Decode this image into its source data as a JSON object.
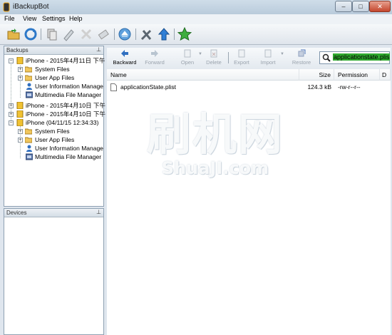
{
  "window": {
    "title": "iBackupBot",
    "minimize": "–",
    "maximize": "□",
    "close": "✕"
  },
  "menu": [
    "File",
    "View",
    "Settings",
    "Help"
  ],
  "backups_panel": {
    "title": "Backups",
    "pin": "📌",
    "items": [
      {
        "label": "iPhone - 2015年4月11日 下午",
        "children": [
          "System Files",
          "User App Files",
          "User Information Manage",
          "Multimedia File Manager"
        ]
      },
      {
        "label": "iPhone - 2015年4月10日 下午"
      },
      {
        "label": "iPhone - 2015年4月10日 下午"
      },
      {
        "label": "iPhone (04/11/15 12:34:33)",
        "children": [
          "System Files",
          "User App Files",
          "User Information Manage",
          "Multimedia File Manager"
        ]
      }
    ]
  },
  "devices_panel": {
    "title": "Devices",
    "pin": "📌"
  },
  "navbar": {
    "backward": "Backward",
    "forward": "Forward",
    "open": "Open",
    "delete": "Delete",
    "export": "Export",
    "import": "Import",
    "restore": "Restore"
  },
  "search": {
    "value": "applicationstate.plis"
  },
  "file_table": {
    "columns": [
      "Name",
      "Size",
      "Permission",
      "D"
    ],
    "rows": [
      {
        "name": "applicationState.plist",
        "size": "124.3 kB",
        "permission": "-rw-r--r--"
      }
    ]
  },
  "watermark": {
    "cn": "刷机网",
    "en": "ShuaJI.com"
  }
}
